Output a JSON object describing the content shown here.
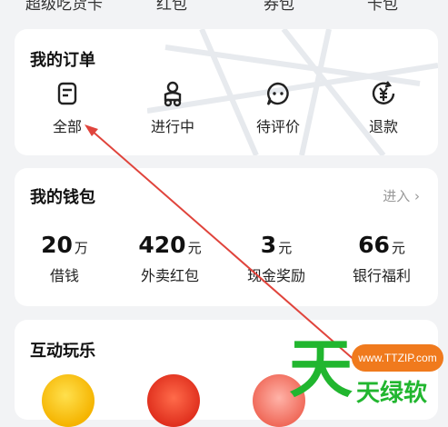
{
  "top_labels": [
    "超级吃货卡",
    "红包",
    "券包",
    "卡包"
  ],
  "orders": {
    "title": "我的订单",
    "items": [
      {
        "label": "全部",
        "icon": "document-icon"
      },
      {
        "label": "进行中",
        "icon": "delivery-icon"
      },
      {
        "label": "待评价",
        "icon": "chat-bubble-icon"
      },
      {
        "label": "退款",
        "icon": "refund-yen-icon"
      }
    ]
  },
  "wallet": {
    "title": "我的钱包",
    "enter": "进入",
    "items": [
      {
        "value": "20",
        "unit": "万",
        "label": "借钱"
      },
      {
        "value": "420",
        "unit": "元",
        "label": "外卖红包"
      },
      {
        "value": "3",
        "unit": "元",
        "label": "现金奖励"
      },
      {
        "value": "66",
        "unit": "元",
        "label": "银行福利"
      }
    ]
  },
  "fun": {
    "title": "互动玩乐"
  },
  "watermark": {
    "url": "www.TTZIP.com",
    "big_char": "天",
    "small_text": "天绿软"
  },
  "colors": {
    "background": "#f2f3f5",
    "arrow": "#e0443c",
    "watermark_green": "#21b62f",
    "watermark_orange": "#f07a1d"
  }
}
